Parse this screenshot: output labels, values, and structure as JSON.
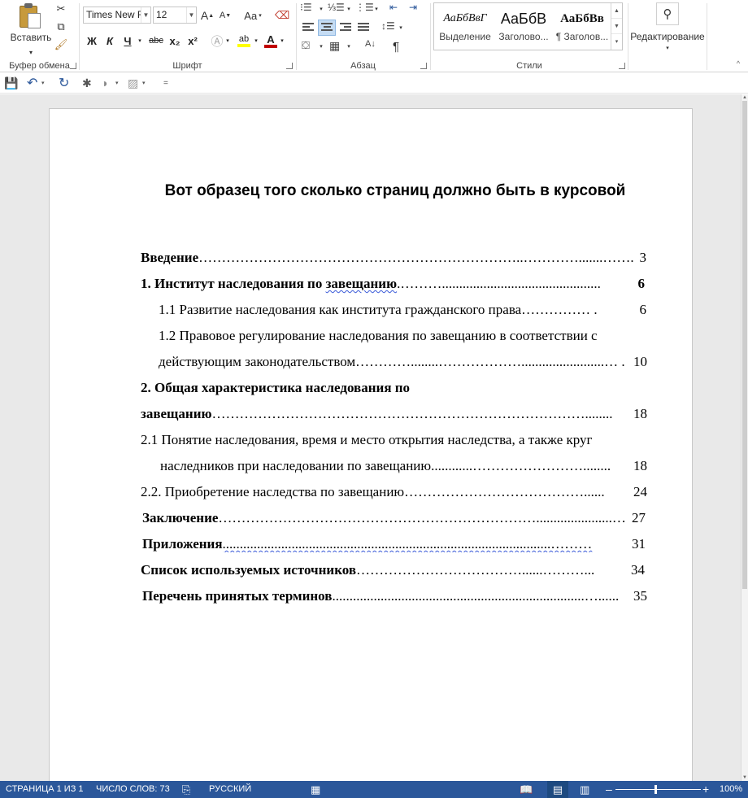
{
  "ribbon": {
    "clipboard": {
      "paste_label": "Вставить",
      "group_label": "Буфер обмена"
    },
    "font": {
      "family_value": "Times New R",
      "size_value": "12",
      "group_label": "Шрифт",
      "grow_label": "A",
      "shrink_label": "A",
      "case_label": "Aa",
      "bold_label": "Ж",
      "italic_label": "К",
      "underline_label": "Ч",
      "strike_label": "abc",
      "subscript_label": "x₂",
      "superscript_label": "x²",
      "highlight_color": "#ffff00",
      "font_color": "#c00000"
    },
    "paragraph": {
      "group_label": "Абзац",
      "pilcrow": "¶"
    },
    "styles": {
      "group_label": "Стили",
      "items": [
        {
          "preview": "АаБбВвГ",
          "name": "Выделение"
        },
        {
          "preview": "АаБбВ",
          "name": "Заголово..."
        },
        {
          "preview": "АаБбВв",
          "name": "¶ Заголов..."
        }
      ]
    },
    "editing": {
      "label": "Редактирование"
    }
  },
  "qat": {
    "customize": "="
  },
  "document": {
    "title": "Вот образец того сколько страниц должно быть в курсовой",
    "toc": [
      {
        "text": "Введение",
        "dots": "……………………………………………………………..………….......…….",
        "page": "3"
      },
      {
        "text": "1. Институт наследования по ",
        "wavy": "завещанию",
        "dots": ".………..............................................",
        "page": "6"
      },
      {
        "text": "1.1  Развитие наследования как института гражданского права ",
        "dots": "…………… .",
        "page": "6"
      },
      {
        "line1": "1.2  Правовое регулирование наследования по завещанию в соответствии с",
        "text": "действующим законодательством",
        "dots": "…………........………………........................… .",
        "page": "10"
      },
      {
        "line1": "2. Общая характеристика наследования по",
        "text": "завещанию",
        "dots": "………………………………………………………………………........",
        "page": "18"
      },
      {
        "line1": "2.1 Понятие наследования, время и место открытия наследства, а также круг",
        "text": "наследников при наследовании по завещанию",
        "dots": "............……………………........",
        "page": "18"
      },
      {
        "text": "2.2. Приобретение наследства по завещанию ",
        "dots": "…………………………………......",
        "page": "24"
      },
      {
        "text": "Заключение",
        "dots": "……………………………………………………………......................…",
        "page": "27"
      },
      {
        "text": "Приложения ",
        "dots": "...............................................................................................………",
        "page": "31"
      },
      {
        "text": "Список используемых источников",
        "dots": "………………………………......………...",
        "page": "34"
      },
      {
        "text": "Перечень принятых терминов",
        "dots": ".........................................................................…......",
        "page": "35"
      }
    ]
  },
  "status": {
    "page": "СТРАНИЦА 1 ИЗ 1",
    "words": "ЧИСЛО СЛОВ: 73",
    "language": "РУССКИЙ",
    "zoom": "100%",
    "minus": "–",
    "plus": "+"
  }
}
